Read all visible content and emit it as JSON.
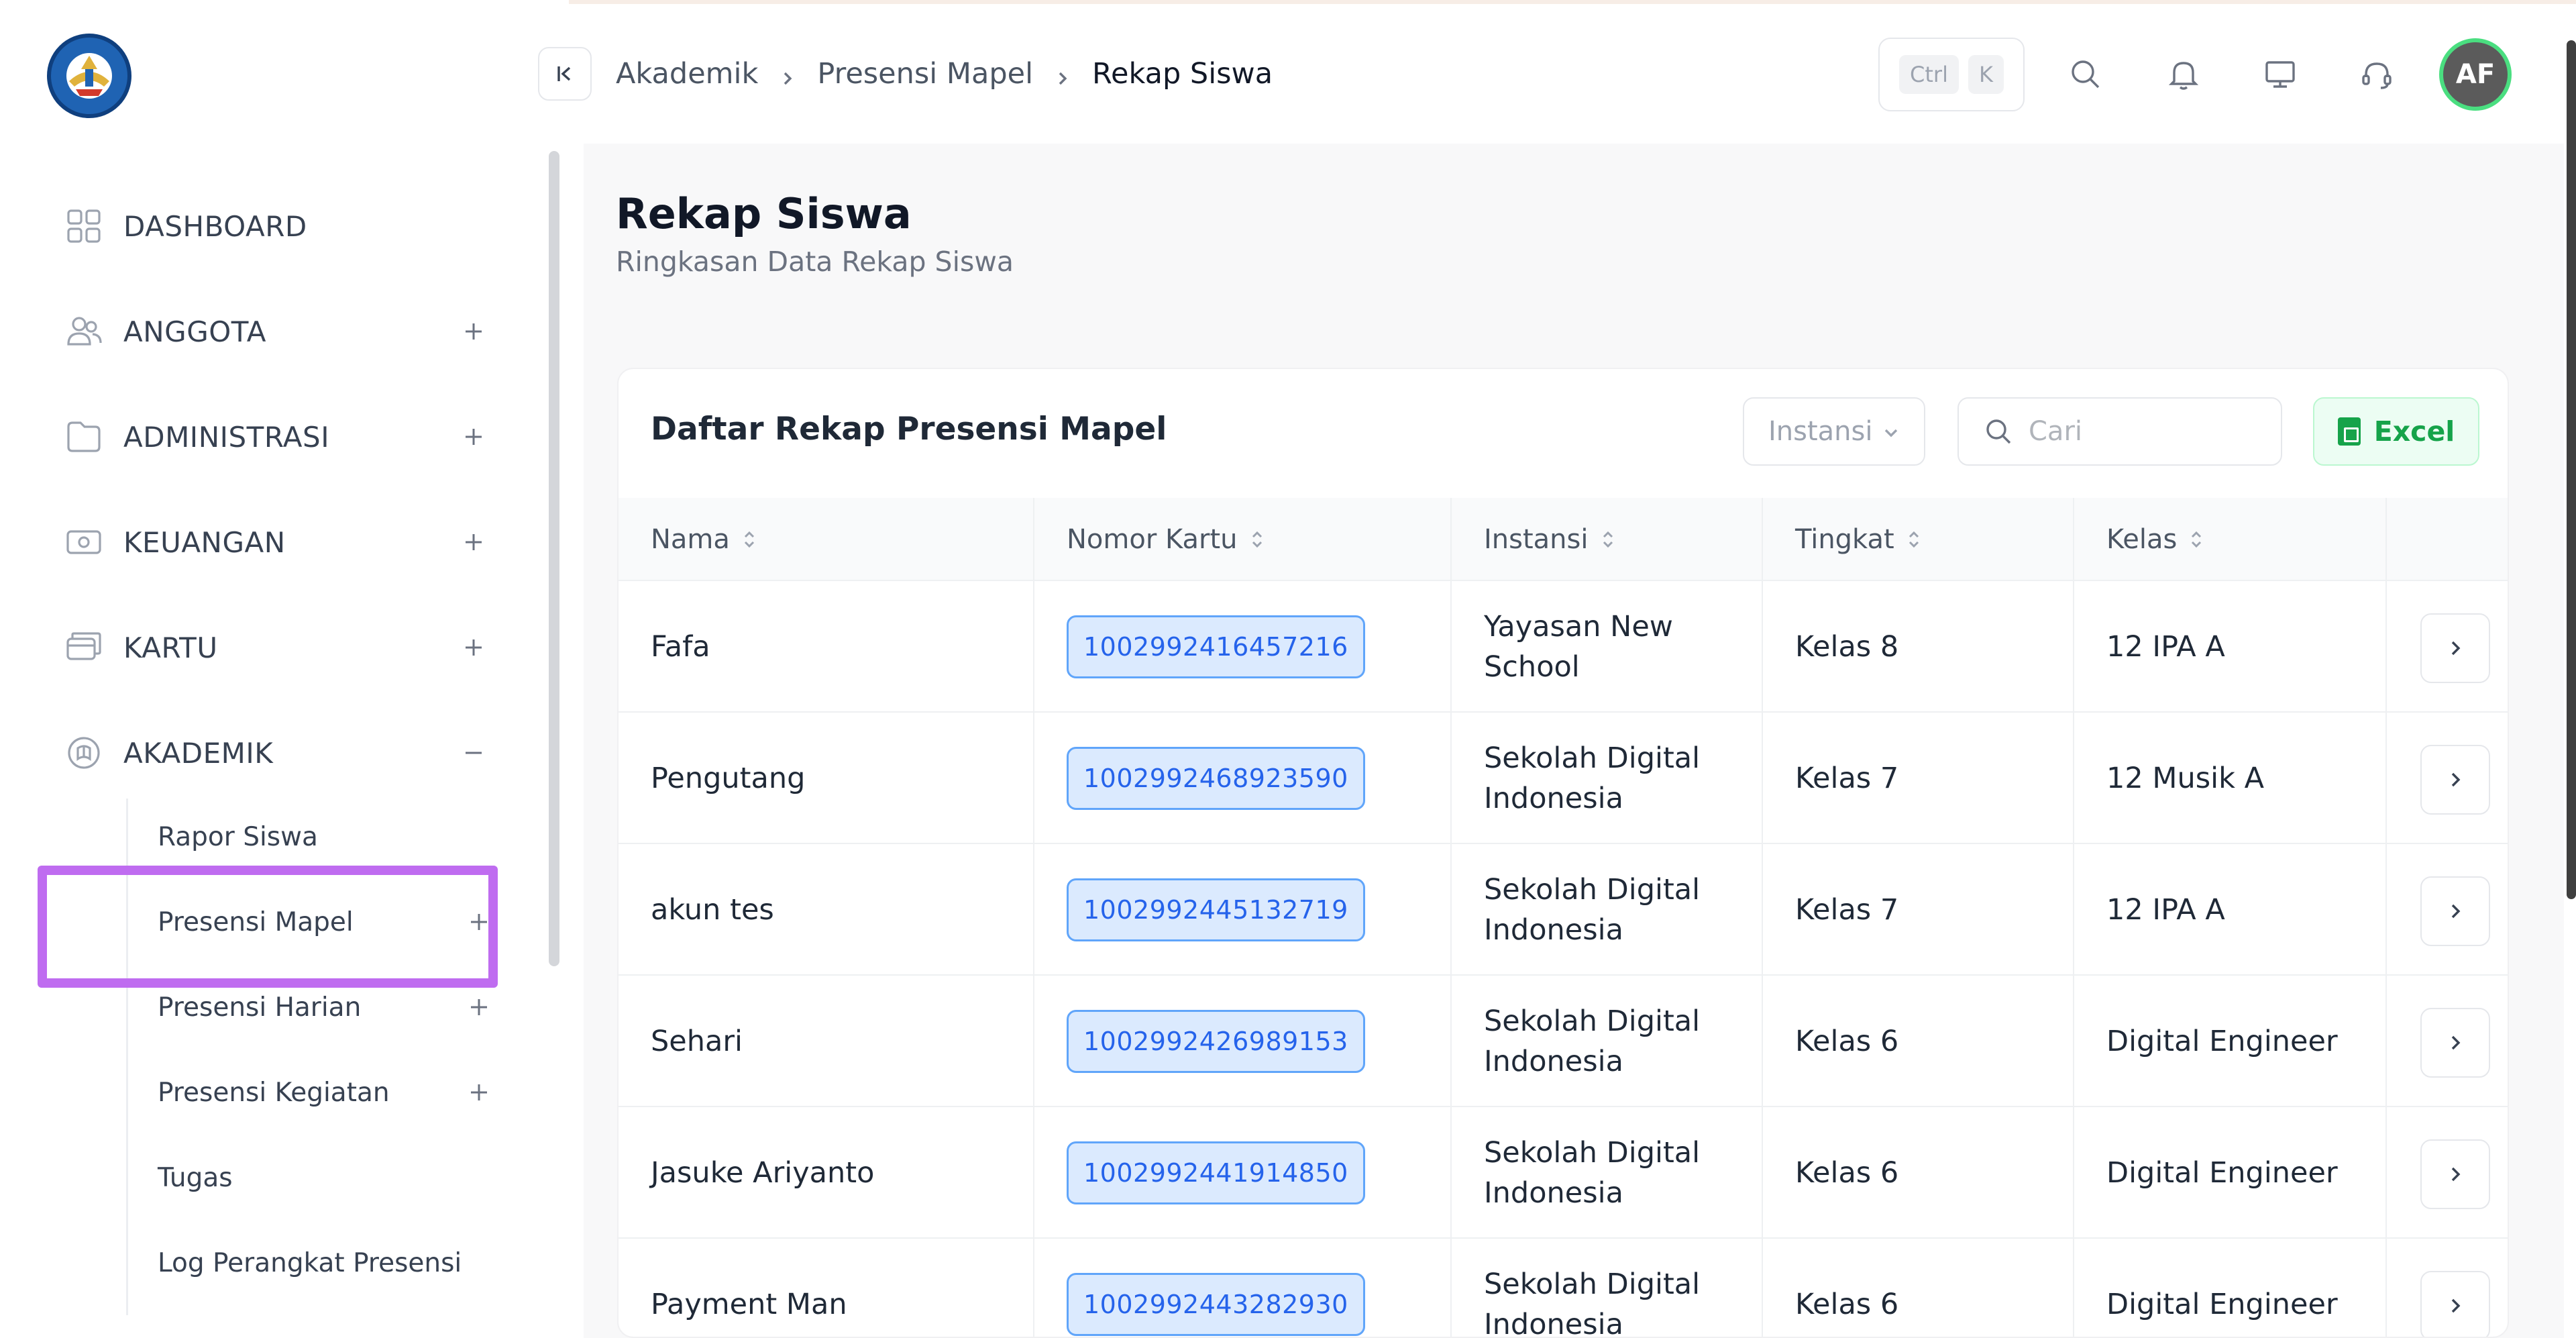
{
  "header": {
    "breadcrumb": [
      "Akademik",
      "Presensi Mapel",
      "Rekap Siswa"
    ],
    "shortcut": {
      "key1": "Ctrl",
      "key2": "K"
    },
    "avatar_initials": "AF"
  },
  "sidebar": {
    "items": [
      {
        "label": "DASHBOARD",
        "icon": "grid-icon",
        "toggle": ""
      },
      {
        "label": "ANGGOTA",
        "icon": "users-icon",
        "toggle": "plus"
      },
      {
        "label": "ADMINISTRASI",
        "icon": "folder-icon",
        "toggle": "plus"
      },
      {
        "label": "KEUANGAN",
        "icon": "money-icon",
        "toggle": "plus"
      },
      {
        "label": "KARTU",
        "icon": "card-icon",
        "toggle": "plus"
      },
      {
        "label": "AKADEMIK",
        "icon": "academic-icon",
        "toggle": "minus"
      }
    ],
    "sub_items": [
      {
        "label": "Rapor Siswa",
        "toggle": ""
      },
      {
        "label": "Presensi Mapel",
        "toggle": "plus"
      },
      {
        "label": "Presensi Harian",
        "toggle": "plus"
      },
      {
        "label": "Presensi Kegiatan",
        "toggle": "plus"
      },
      {
        "label": "Tugas",
        "toggle": ""
      },
      {
        "label": "Log Perangkat Presensi",
        "toggle": ""
      }
    ],
    "highlight_color": "#bf6cf0"
  },
  "page": {
    "title": "Rekap Siswa",
    "subtitle": "Ringkasan Data Rekap Siswa"
  },
  "table_card": {
    "title": "Daftar Rekap Presensi Mapel",
    "filter_label": "Instansi",
    "search_placeholder": "Cari",
    "excel_label": "Excel",
    "columns": [
      "Nama",
      "Nomor Kartu",
      "Instansi",
      "Tingkat",
      "Kelas"
    ],
    "rows": [
      {
        "nama": "Fafa",
        "nomor_kartu": "1002992416457216",
        "instansi_1": "Yayasan New",
        "instansi_2": "School",
        "tingkat": "Kelas 8",
        "kelas": "12 IPA A"
      },
      {
        "nama": "Pengutang",
        "nomor_kartu": "1002992468923590",
        "instansi_1": "Sekolah Digital",
        "instansi_2": "Indonesia",
        "tingkat": "Kelas 7",
        "kelas": "12 Musik A"
      },
      {
        "nama": "akun tes",
        "nomor_kartu": "1002992445132719",
        "instansi_1": "Sekolah Digital",
        "instansi_2": "Indonesia",
        "tingkat": "Kelas 7",
        "kelas": "12 IPA A"
      },
      {
        "nama": "Sehari",
        "nomor_kartu": "1002992426989153",
        "instansi_1": "Sekolah Digital",
        "instansi_2": "Indonesia",
        "tingkat": "Kelas 6",
        "kelas": "Digital Engineer"
      },
      {
        "nama": "Jasuke Ariyanto",
        "nomor_kartu": "1002992441914850",
        "instansi_1": "Sekolah Digital",
        "instansi_2": "Indonesia",
        "tingkat": "Kelas 6",
        "kelas": "Digital Engineer"
      },
      {
        "nama": "Payment Man",
        "nomor_kartu": "1002992443282930",
        "instansi_1": "Sekolah Digital",
        "instansi_2": "Indonesia",
        "tingkat": "Kelas 6",
        "kelas": "Digital Engineer"
      }
    ]
  },
  "colors": {
    "accent": "#2563eb",
    "excel": "#16a34a",
    "avatar_ring": "#4ade80"
  }
}
